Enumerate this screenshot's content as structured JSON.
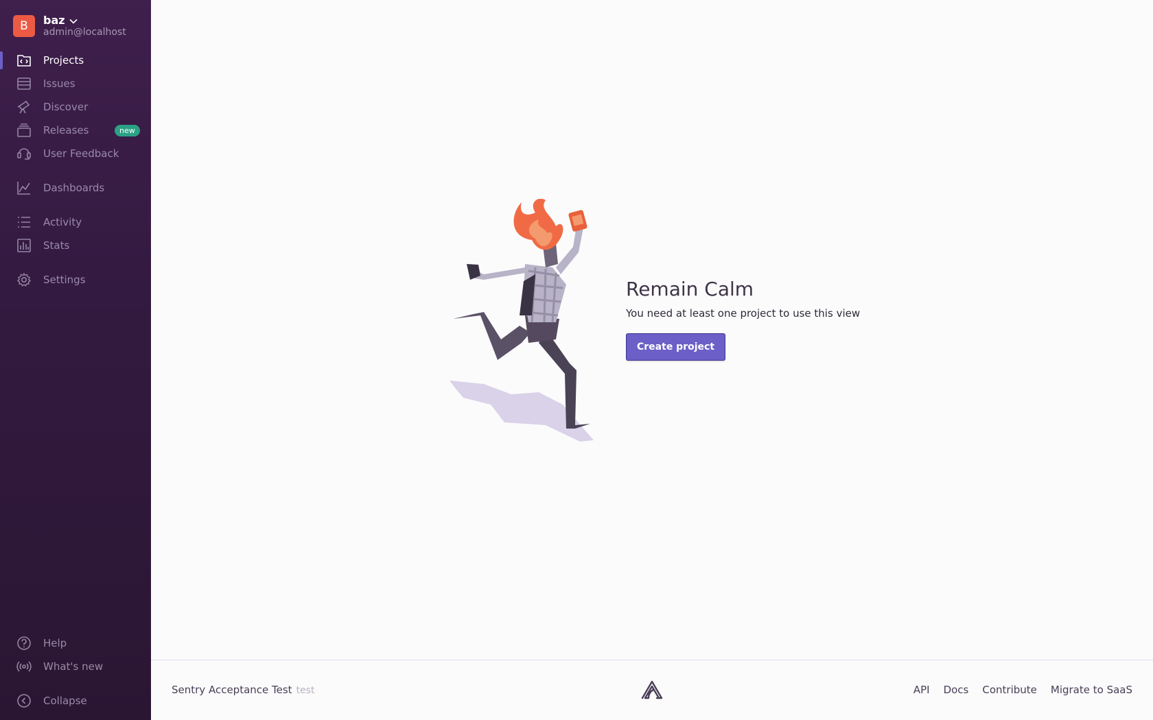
{
  "org": {
    "avatar_letter": "B",
    "name": "baz",
    "email": "admin@localhost"
  },
  "nav": {
    "projects": "Projects",
    "issues": "Issues",
    "discover": "Discover",
    "releases": "Releases",
    "releases_badge": "new",
    "user_feedback": "User Feedback",
    "dashboards": "Dashboards",
    "activity": "Activity",
    "stats": "Stats",
    "settings": "Settings",
    "help": "Help",
    "whats_new": "What's new",
    "collapse": "Collapse"
  },
  "empty_state": {
    "title": "Remain Calm",
    "description": "You need at least one project to use this view",
    "button_label": "Create project"
  },
  "footer": {
    "site_name": "Sentry Acceptance Test",
    "environment": "test",
    "links": {
      "api": "API",
      "docs": "Docs",
      "contribute": "Contribute",
      "migrate": "Migrate to SaaS"
    }
  },
  "colors": {
    "sidebar_bg": "#3f1f4c",
    "accent": "#6c5fc7",
    "avatar": "#ed5a44",
    "badge_new": "#2ba185"
  },
  "icons": [
    "projects-icon",
    "issues-icon",
    "discover-icon",
    "releases-icon",
    "user-feedback-icon",
    "dashboards-icon",
    "activity-icon",
    "stats-icon",
    "settings-icon",
    "help-icon",
    "whats-new-icon",
    "collapse-icon",
    "sentry-logo-icon",
    "chevron-down-icon"
  ]
}
